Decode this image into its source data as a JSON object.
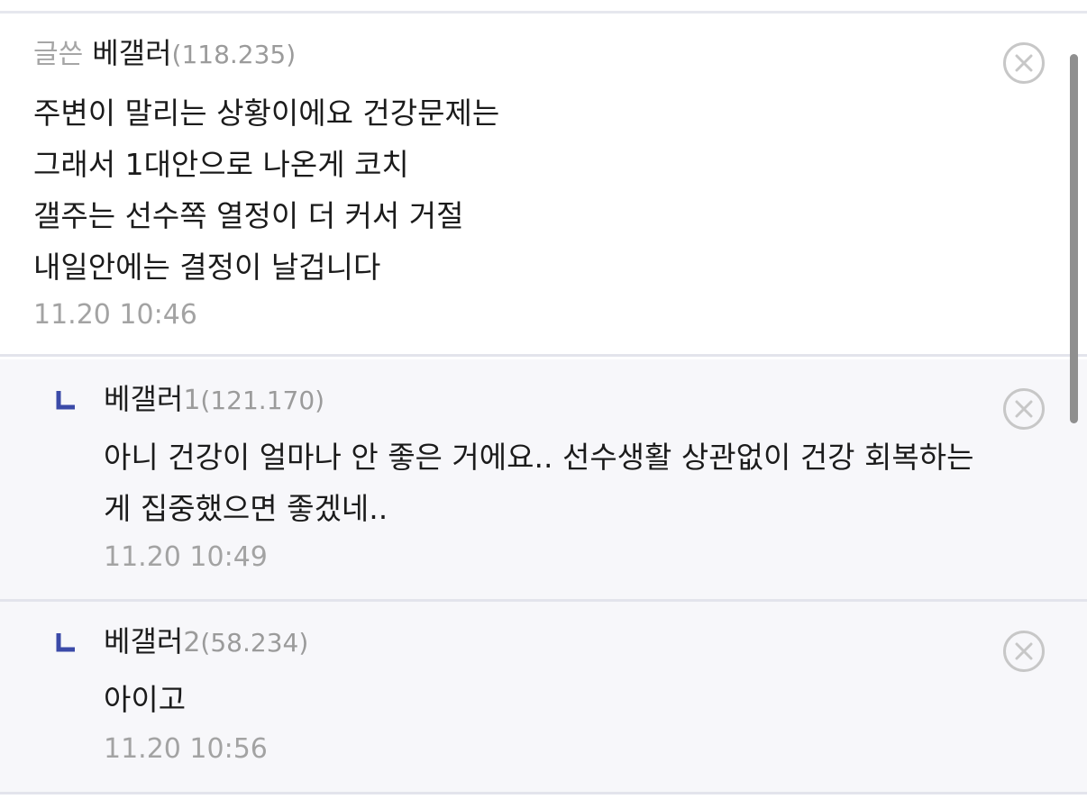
{
  "comments": [
    {
      "prefix": "글쓴",
      "nick": "베갤러",
      "nick_num": "",
      "ip": "(118.235)",
      "body": "주변이 말리는 상황이에요 건강문제는\n그래서 1대안으로 나온게 코치\n갤주는 선수쪽 열정이 더 커서 거절\n내일안에는 결정이 날겁니다",
      "time": "11.20 10:46"
    },
    {
      "nick": "베갤러",
      "nick_num": "1",
      "ip": "(121.170)",
      "body": "아니 건강이 얼마나 안 좋은 거에요.. 선수생활 상관없이 건강 회복하는\n게 집중했으면 좋겠네..",
      "time": "11.20 10:49"
    },
    {
      "nick": "베갤러",
      "nick_num": "2",
      "ip": "(58.234)",
      "body": "아이고",
      "time": "11.20 10:56"
    }
  ],
  "icons": {
    "close": "close-circle-icon",
    "reply": "reply-corner-icon"
  },
  "colors": {
    "reply_mark": "#3b4aa8",
    "reply_background": "#f7f7fa",
    "divider": "#e3e4ec",
    "meta_text": "#a3a3a3"
  }
}
